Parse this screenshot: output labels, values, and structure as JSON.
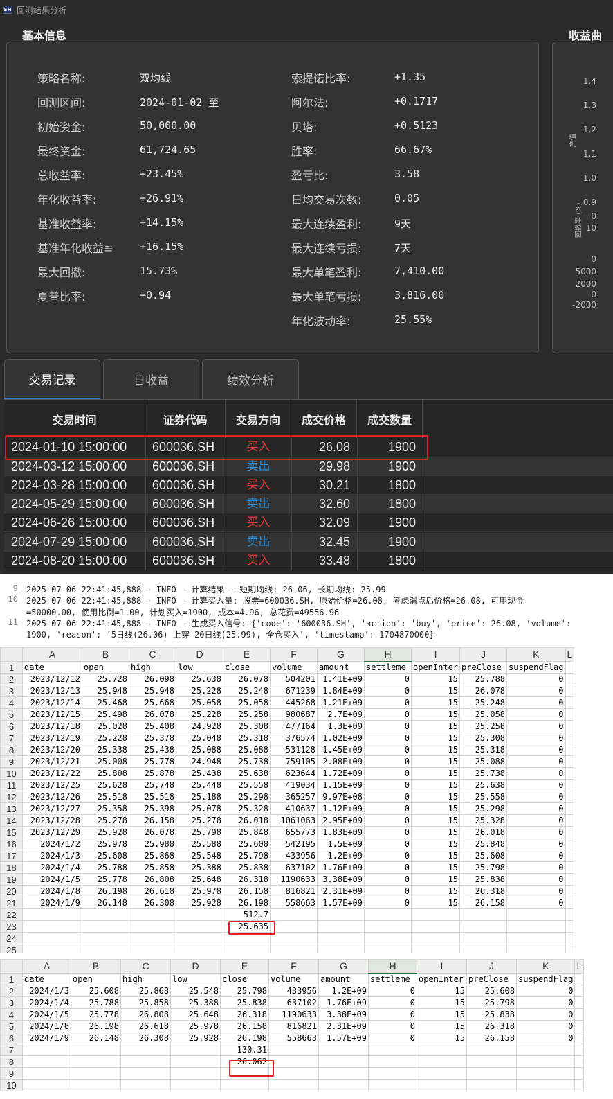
{
  "window": {
    "title": "回测结果分析",
    "icon": "SH"
  },
  "basic_info": {
    "title": "基本信息",
    "left": [
      {
        "label": "策略名称:",
        "value": "双均线"
      },
      {
        "label": "回测区间:",
        "value": "2024-01-02 至"
      },
      {
        "label": "初始资金:",
        "value": "50,000.00"
      },
      {
        "label": "最终资金:",
        "value": "61,724.65"
      },
      {
        "label": "总收益率:",
        "value": "+23.45%"
      },
      {
        "label": "年化收益率:",
        "value": "+26.91%"
      },
      {
        "label": "基准收益率:",
        "value": "+14.15%"
      },
      {
        "label": "基准年化收益≊",
        "value": "+16.15%"
      },
      {
        "label": "最大回撤:",
        "value": "15.73%"
      },
      {
        "label": "夏普比率:",
        "value": "+0.94"
      }
    ],
    "right": [
      {
        "label": "索提诺比率:",
        "value": "+1.35"
      },
      {
        "label": "阿尔法:",
        "value": "+0.1717"
      },
      {
        "label": "贝塔:",
        "value": "+0.5123"
      },
      {
        "label": "胜率:",
        "value": "66.67%"
      },
      {
        "label": "盈亏比:",
        "value": "3.58"
      },
      {
        "label": "日均交易次数:",
        "value": "0.05"
      },
      {
        "label": "最大连续盈利:",
        "value": "9天"
      },
      {
        "label": "最大连续亏损:",
        "value": "7天"
      },
      {
        "label": "最大单笔盈利:",
        "value": "7,410.00"
      },
      {
        "label": "最大单笔亏损:",
        "value": "3,816.00"
      },
      {
        "label": "年化波动率:",
        "value": "25.55%"
      }
    ]
  },
  "chart_panel": {
    "title": "收益曲",
    "y_labels_top": [
      "1.4",
      "1.3",
      "1.2",
      "1.1",
      "1.0",
      "0.9"
    ],
    "y_labels_mid": [
      "0",
      "10",
      "0"
    ],
    "y_labels_bot": [
      "5000",
      "2000",
      "0",
      "-2000"
    ],
    "axis_title_1": "产值",
    "axis_title_2": "回撤率 (%)"
  },
  "tabs": [
    {
      "label": "交易记录"
    },
    {
      "label": "日收益"
    },
    {
      "label": "绩效分析"
    }
  ],
  "trades": {
    "headers": [
      "交易时间",
      "证券代码",
      "交易方向",
      "成交价格",
      "成交数量"
    ],
    "rows": [
      {
        "time": "2024-01-10 15:00:00",
        "code": "600036.SH",
        "dir": "买入",
        "price": "26.08",
        "qty": "1900"
      },
      {
        "time": "2024-03-12 15:00:00",
        "code": "600036.SH",
        "dir": "卖出",
        "price": "29.98",
        "qty": "1900"
      },
      {
        "time": "2024-03-28 15:00:00",
        "code": "600036.SH",
        "dir": "买入",
        "price": "30.21",
        "qty": "1800"
      },
      {
        "time": "2024-05-29 15:00:00",
        "code": "600036.SH",
        "dir": "卖出",
        "price": "32.60",
        "qty": "1800"
      },
      {
        "time": "2024-06-26 15:00:00",
        "code": "600036.SH",
        "dir": "买入",
        "price": "32.09",
        "qty": "1900"
      },
      {
        "time": "2024-07-29 15:00:00",
        "code": "600036.SH",
        "dir": "卖出",
        "price": "32.45",
        "qty": "1900"
      },
      {
        "time": "2024-08-20 15:00:00",
        "code": "600036.SH",
        "dir": "买入",
        "price": "33.48",
        "qty": "1800"
      }
    ],
    "colors": {
      "buy": "#e53935",
      "sell": "#2f8fd8"
    }
  },
  "log": [
    {
      "no": "9",
      "text": "2025-07-06 22:41:45,888 - INFO - 计算结果 - 短期均线: 26.06, 长期均线: 25.99"
    },
    {
      "no": "10",
      "text": "2025-07-06 22:41:45,888 - INFO - 计算买入量: 股票=600036.SH, 原始价格=26.08, 考虑滑点后价格=26.08, 可用现金"
    },
    {
      "no": "",
      "text": "=50000.00, 使用比例=1.00, 计划买入=1900, 成本=4.96, 总花费=49556.96"
    },
    {
      "no": "11",
      "text": "2025-07-06 22:41:45,888 - INFO - 生成买入信号: {'code': '600036.SH', 'action': 'buy', 'price': 26.08, 'volume':"
    },
    {
      "no": "",
      "text": "1900, 'reason': '5日线(26.06) 上穿 20日线(25.99), 全仓买入', 'timestamp': 1704870000}"
    }
  ],
  "sheet1": {
    "cols": [
      "A",
      "B",
      "C",
      "D",
      "E",
      "F",
      "G",
      "H",
      "I",
      "J",
      "K",
      "L"
    ],
    "header": [
      "date",
      "open",
      "high",
      "low",
      "close",
      "volume",
      "amount",
      "settleme",
      "openInter",
      "preClose",
      "suspendFlag",
      ""
    ],
    "rows": [
      [
        "2023/12/12",
        "25.728",
        "26.098",
        "25.638",
        "26.078",
        "504201",
        "1.41E+09",
        "0",
        "15",
        "25.788",
        "0"
      ],
      [
        "2023/12/13",
        "25.948",
        "25.948",
        "25.228",
        "25.248",
        "671239",
        "1.84E+09",
        "0",
        "15",
        "26.078",
        "0"
      ],
      [
        "2023/12/14",
        "25.468",
        "25.668",
        "25.058",
        "25.058",
        "445268",
        "1.21E+09",
        "0",
        "15",
        "25.248",
        "0"
      ],
      [
        "2023/12/15",
        "25.498",
        "26.078",
        "25.228",
        "25.258",
        "980687",
        "2.7E+09",
        "0",
        "15",
        "25.058",
        "0"
      ],
      [
        "2023/12/18",
        "25.028",
        "25.408",
        "24.928",
        "25.308",
        "477164",
        "1.3E+09",
        "0",
        "15",
        "25.258",
        "0"
      ],
      [
        "2023/12/19",
        "25.228",
        "25.378",
        "25.048",
        "25.318",
        "376574",
        "1.02E+09",
        "0",
        "15",
        "25.308",
        "0"
      ],
      [
        "2023/12/20",
        "25.338",
        "25.438",
        "25.088",
        "25.088",
        "531128",
        "1.45E+09",
        "0",
        "15",
        "25.318",
        "0"
      ],
      [
        "2023/12/21",
        "25.008",
        "25.778",
        "24.948",
        "25.738",
        "759105",
        "2.08E+09",
        "0",
        "15",
        "25.088",
        "0"
      ],
      [
        "2023/12/22",
        "25.808",
        "25.878",
        "25.438",
        "25.638",
        "623644",
        "1.72E+09",
        "0",
        "15",
        "25.738",
        "0"
      ],
      [
        "2023/12/25",
        "25.628",
        "25.748",
        "25.448",
        "25.558",
        "419034",
        "1.15E+09",
        "0",
        "15",
        "25.638",
        "0"
      ],
      [
        "2023/12/26",
        "25.518",
        "25.518",
        "25.188",
        "25.298",
        "365257",
        "9.97E+08",
        "0",
        "15",
        "25.558",
        "0"
      ],
      [
        "2023/12/27",
        "25.358",
        "25.398",
        "25.078",
        "25.328",
        "410637",
        "1.12E+09",
        "0",
        "15",
        "25.298",
        "0"
      ],
      [
        "2023/12/28",
        "25.278",
        "26.158",
        "25.278",
        "26.018",
        "1061063",
        "2.95E+09",
        "0",
        "15",
        "25.328",
        "0"
      ],
      [
        "2023/12/29",
        "25.928",
        "26.078",
        "25.798",
        "25.848",
        "655773",
        "1.83E+09",
        "0",
        "15",
        "26.018",
        "0"
      ],
      [
        "2024/1/2",
        "25.978",
        "25.988",
        "25.588",
        "25.608",
        "542195",
        "1.5E+09",
        "0",
        "15",
        "25.848",
        "0"
      ],
      [
        "2024/1/3",
        "25.608",
        "25.868",
        "25.548",
        "25.798",
        "433956",
        "1.2E+09",
        "0",
        "15",
        "25.608",
        "0"
      ],
      [
        "2024/1/4",
        "25.788",
        "25.858",
        "25.388",
        "25.838",
        "637102",
        "1.76E+09",
        "0",
        "15",
        "25.798",
        "0"
      ],
      [
        "2024/1/5",
        "25.778",
        "26.808",
        "25.648",
        "26.318",
        "1190633",
        "3.38E+09",
        "0",
        "15",
        "25.838",
        "0"
      ],
      [
        "2024/1/8",
        "26.198",
        "26.618",
        "25.978",
        "26.158",
        "816821",
        "2.31E+09",
        "0",
        "15",
        "26.318",
        "0"
      ],
      [
        "2024/1/9",
        "26.148",
        "26.308",
        "25.928",
        "26.198",
        "558663",
        "1.57E+09",
        "0",
        "15",
        "26.158",
        "0"
      ]
    ],
    "sum": "512.7",
    "avg": "25.635"
  },
  "sheet2": {
    "cols": [
      "A",
      "B",
      "C",
      "D",
      "E",
      "F",
      "G",
      "H",
      "I",
      "J",
      "K",
      "L"
    ],
    "header": [
      "date",
      "open",
      "high",
      "low",
      "close",
      "volume",
      "amount",
      "settleme",
      "openInter",
      "preClose",
      "suspendFlag",
      ""
    ],
    "rows": [
      [
        "2024/1/3",
        "25.608",
        "25.868",
        "25.548",
        "25.798",
        "433956",
        "1.2E+09",
        "0",
        "15",
        "25.608",
        "0"
      ],
      [
        "2024/1/4",
        "25.788",
        "25.858",
        "25.388",
        "25.838",
        "637102",
        "1.76E+09",
        "0",
        "15",
        "25.798",
        "0"
      ],
      [
        "2024/1/5",
        "25.778",
        "26.808",
        "25.648",
        "26.318",
        "1190633",
        "3.38E+09",
        "0",
        "15",
        "25.838",
        "0"
      ],
      [
        "2024/1/8",
        "26.198",
        "26.618",
        "25.978",
        "26.158",
        "816821",
        "2.31E+09",
        "0",
        "15",
        "26.318",
        "0"
      ],
      [
        "2024/1/9",
        "26.148",
        "26.308",
        "25.928",
        "26.198",
        "558663",
        "1.57E+09",
        "0",
        "15",
        "26.158",
        "0"
      ]
    ],
    "sum": "130.31",
    "avg": "26.062"
  }
}
